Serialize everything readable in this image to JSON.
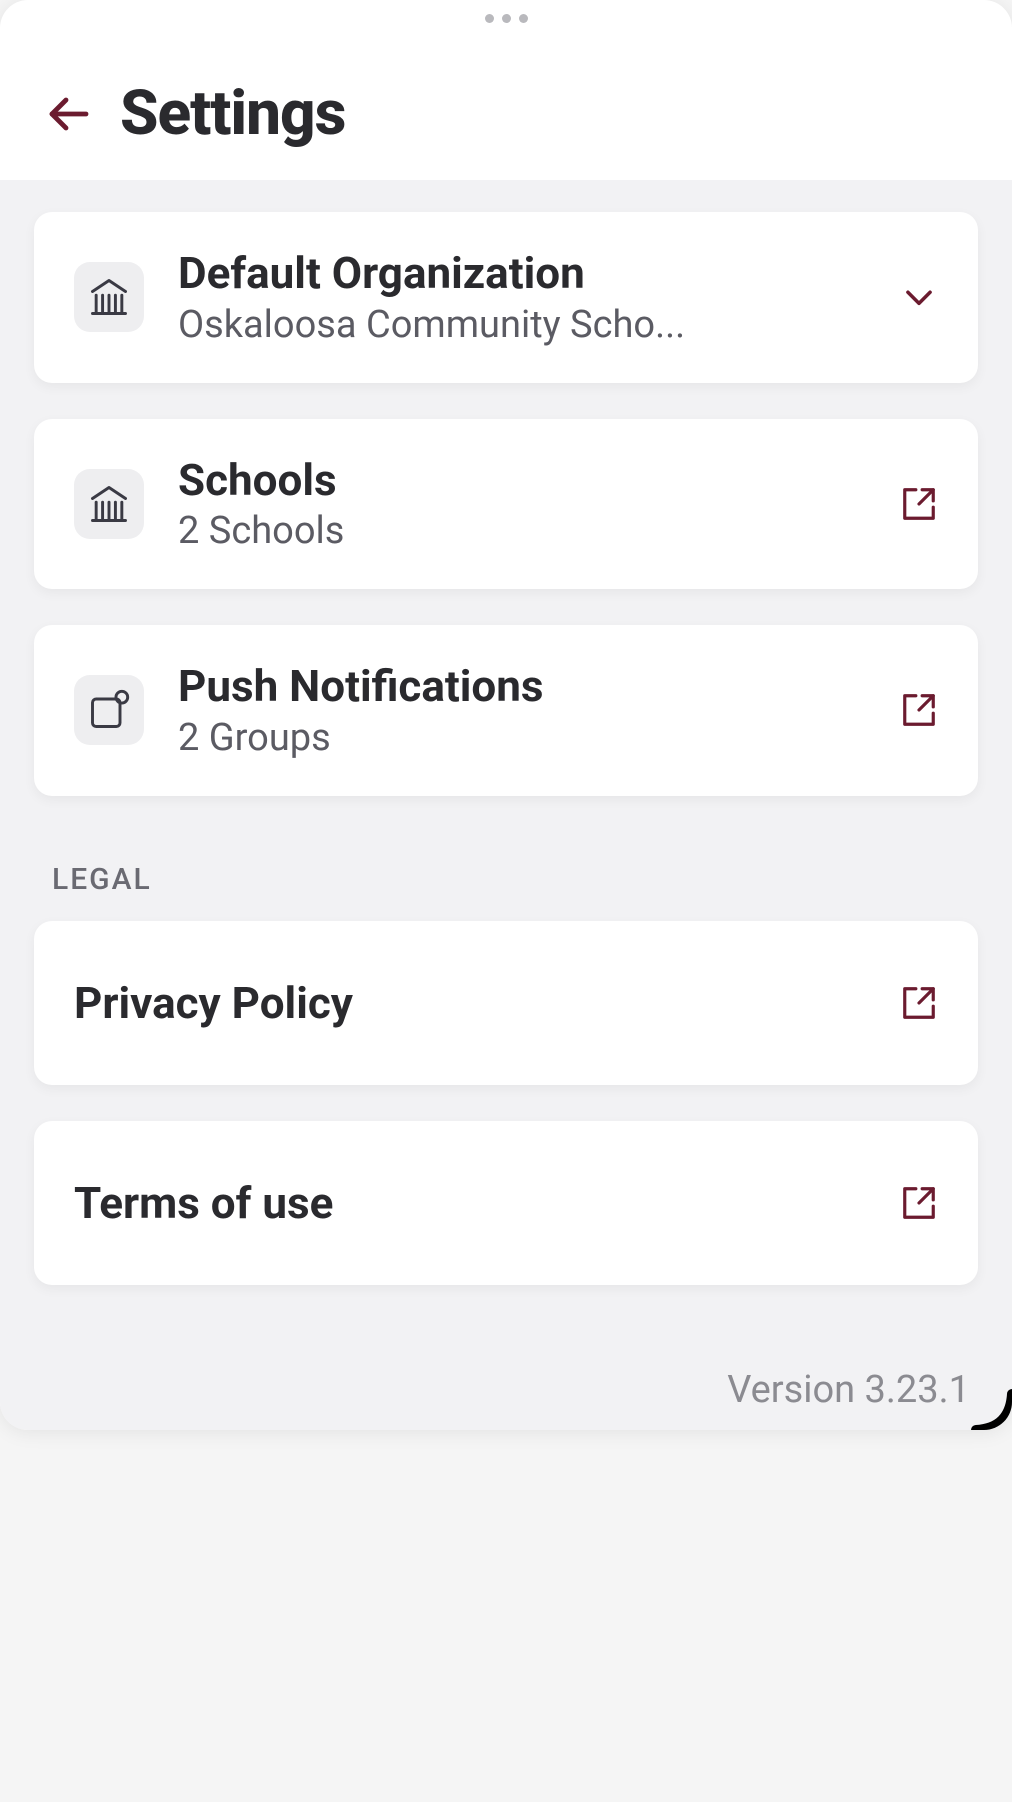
{
  "header": {
    "title": "Settings"
  },
  "cards": {
    "org": {
      "title": "Default Organization",
      "subtitle": "Oskaloosa Community Scho..."
    },
    "schools": {
      "title": "Schools",
      "subtitle": "2 Schools"
    },
    "push": {
      "title": "Push Notifications",
      "subtitle": "2 Groups"
    }
  },
  "legal": {
    "label": "LEGAL",
    "privacy": "Privacy Policy",
    "terms": "Terms of use"
  },
  "footer": {
    "version": "Version 3.23.1"
  },
  "colors": {
    "accent": "#6b1b2f"
  }
}
